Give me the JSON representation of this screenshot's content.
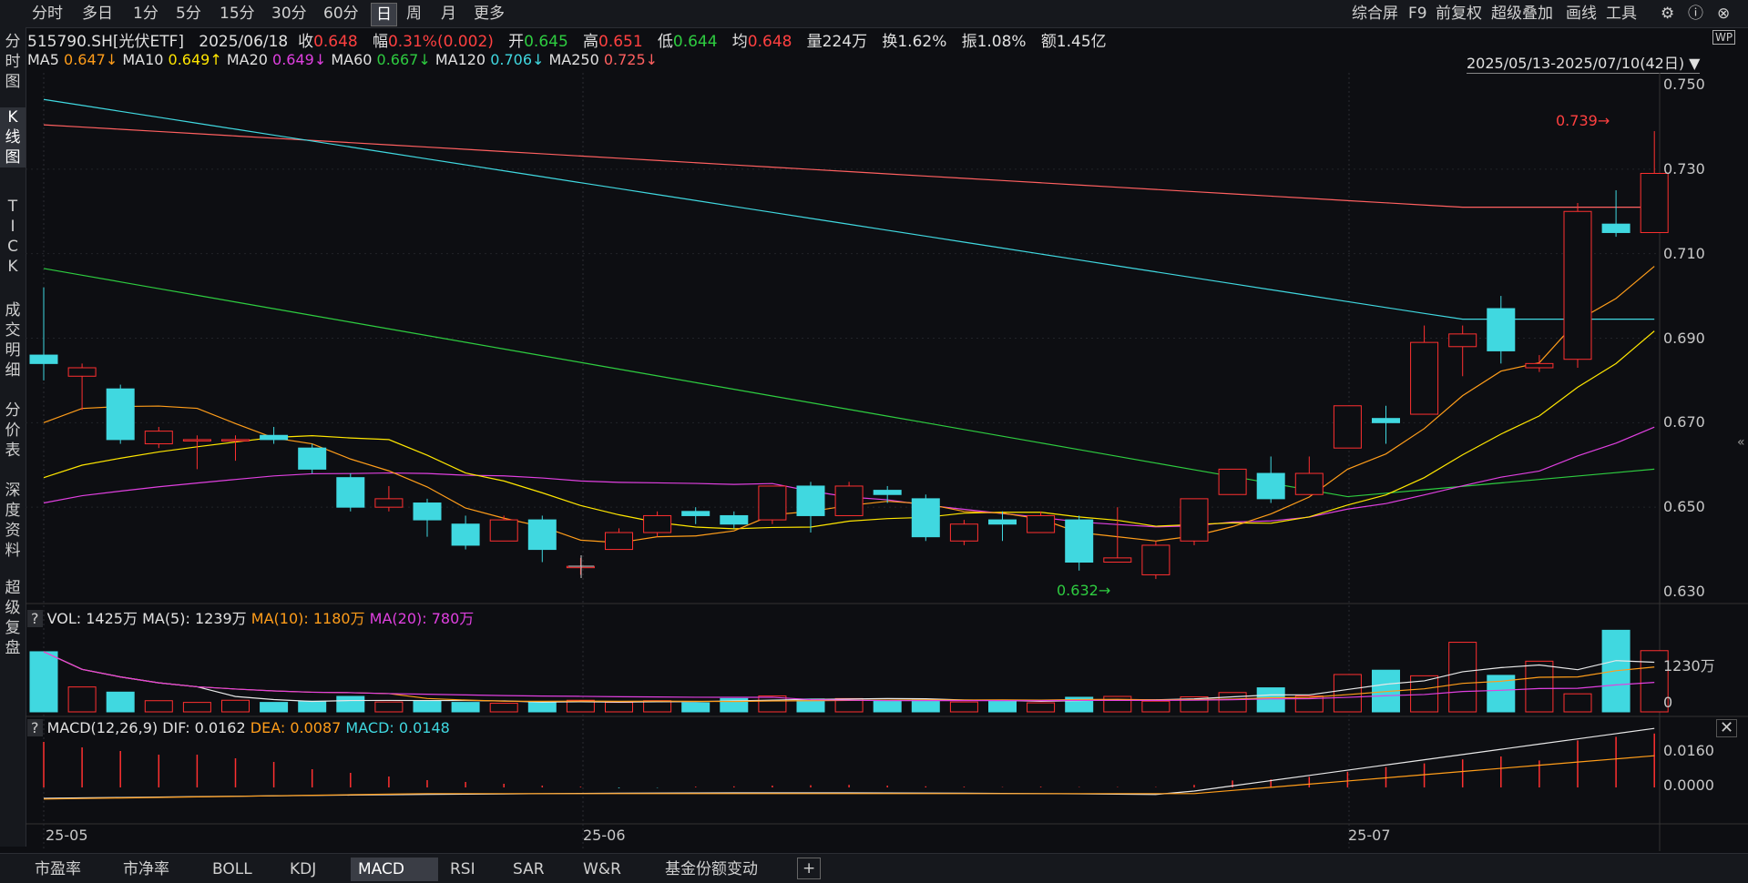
{
  "toolbar": {
    "periods": [
      "分时",
      "多日",
      "1分",
      "5分",
      "15分",
      "30分",
      "60分",
      "日",
      "周",
      "月",
      "更多"
    ],
    "active_period": "日",
    "right_items": [
      "综合屏",
      "F9",
      "前复权",
      "超级叠加",
      "画线",
      "工具"
    ]
  },
  "leftnav": {
    "items": [
      "分\n时\n图",
      "K\n线\n图",
      "T\nI\nC\nK",
      "成\n交\n明\n细",
      "分\n价\n表",
      "深\n度\n资\n料",
      "超\n级\n复\n盘"
    ],
    "active": "K\n线\n图"
  },
  "quote": {
    "code": "515790.SH[光伏ETF]",
    "date": "2025/06/18",
    "close_label": "收",
    "close": "0.648",
    "change_label": "幅",
    "change": "0.31%(0.002)",
    "open_label": "开",
    "open": "0.645",
    "high_label": "高",
    "high": "0.651",
    "low_label": "低",
    "low": "0.644",
    "avg_label": "均",
    "avg": "0.648",
    "volume": "量224万",
    "turnover_rate": "换1.62%",
    "amplitude": "振1.08%",
    "amount": "额1.45亿"
  },
  "ma_legend": [
    {
      "name": "MA5",
      "value": "0.647↓",
      "color": "#ff9d1a"
    },
    {
      "name": "MA10",
      "value": "0.649↑",
      "color": "#ffe600"
    },
    {
      "name": "MA20",
      "value": "0.649↓",
      "color": "#e040e0"
    },
    {
      "name": "MA60",
      "value": "0.667↓",
      "color": "#2ecc40"
    },
    {
      "name": "MA120",
      "value": "0.706↓",
      "color": "#40d8e0"
    },
    {
      "name": "MA250",
      "value": "0.725↓",
      "color": "#ff6060"
    }
  ],
  "date_range": "2025/05/13-2025/07/10(42日)",
  "price_axis": [
    "0.750",
    "0.730",
    "0.710",
    "0.690",
    "0.670",
    "0.650",
    "0.630"
  ],
  "annotations": {
    "max": "0.739",
    "min": "0.632"
  },
  "vol_panel": {
    "label": "VOL: 1425万",
    "ma5": "MA(5): 1239万",
    "ma10": "MA(10): 1180万",
    "ma20": "MA(20): 780万",
    "axis": [
      "1230万",
      "0"
    ]
  },
  "macd_panel": {
    "label": "MACD(12,26,9)",
    "dif": "DIF: 0.0162",
    "dea": "DEA: 0.0087",
    "macd": "MACD: 0.0148",
    "axis": [
      "0.0160",
      "0.0000"
    ]
  },
  "x_axis": [
    "25-05",
    "25-06",
    "25-07"
  ],
  "bottom_tabs": [
    "市盈率",
    "市净率",
    "BOLL",
    "KDJ",
    "MACD",
    "RSI",
    "SAR",
    "W&R",
    "基金份额变动"
  ],
  "active_tab": "MACD",
  "chart_data": {
    "type": "candlestick",
    "candles": [
      {
        "o": 0.686,
        "c": 0.684,
        "h": 0.702,
        "l": 0.68
      },
      {
        "o": 0.681,
        "c": 0.683,
        "h": 0.684,
        "l": 0.673
      },
      {
        "o": 0.678,
        "c": 0.666,
        "h": 0.679,
        "l": 0.665
      },
      {
        "o": 0.665,
        "c": 0.668,
        "h": 0.669,
        "l": 0.664
      },
      {
        "o": 0.666,
        "c": 0.666,
        "h": 0.667,
        "l": 0.659
      },
      {
        "o": 0.666,
        "c": 0.666,
        "h": 0.667,
        "l": 0.661
      },
      {
        "o": 0.667,
        "c": 0.666,
        "h": 0.669,
        "l": 0.665
      },
      {
        "o": 0.664,
        "c": 0.659,
        "h": 0.665,
        "l": 0.658
      },
      {
        "o": 0.657,
        "c": 0.65,
        "h": 0.658,
        "l": 0.649
      },
      {
        "o": 0.65,
        "c": 0.652,
        "h": 0.655,
        "l": 0.649
      },
      {
        "o": 0.651,
        "c": 0.647,
        "h": 0.652,
        "l": 0.643
      },
      {
        "o": 0.646,
        "c": 0.641,
        "h": 0.648,
        "l": 0.64
      },
      {
        "o": 0.642,
        "c": 0.647,
        "h": 0.648,
        "l": 0.642
      },
      {
        "o": 0.647,
        "c": 0.64,
        "h": 0.648,
        "l": 0.637
      },
      {
        "o": 0.636,
        "c": 0.636,
        "h": 0.638,
        "l": 0.634
      },
      {
        "o": 0.64,
        "c": 0.644,
        "h": 0.645,
        "l": 0.64
      },
      {
        "o": 0.644,
        "c": 0.648,
        "h": 0.649,
        "l": 0.643
      },
      {
        "o": 0.649,
        "c": 0.648,
        "h": 0.65,
        "l": 0.646
      },
      {
        "o": 0.648,
        "c": 0.646,
        "h": 0.649,
        "l": 0.645
      },
      {
        "o": 0.647,
        "c": 0.655,
        "h": 0.655,
        "l": 0.646
      },
      {
        "o": 0.655,
        "c": 0.648,
        "h": 0.656,
        "l": 0.644
      },
      {
        "o": 0.648,
        "c": 0.655,
        "h": 0.656,
        "l": 0.648
      },
      {
        "o": 0.654,
        "c": 0.653,
        "h": 0.655,
        "l": 0.651
      },
      {
        "o": 0.652,
        "c": 0.643,
        "h": 0.653,
        "l": 0.642
      },
      {
        "o": 0.642,
        "c": 0.646,
        "h": 0.647,
        "l": 0.641
      },
      {
        "o": 0.647,
        "c": 0.646,
        "h": 0.649,
        "l": 0.642
      },
      {
        "o": 0.644,
        "c": 0.648,
        "h": 0.649,
        "l": 0.644
      },
      {
        "o": 0.647,
        "c": 0.637,
        "h": 0.648,
        "l": 0.635
      },
      {
        "o": 0.637,
        "c": 0.638,
        "h": 0.65,
        "l": 0.637
      },
      {
        "o": 0.634,
        "c": 0.641,
        "h": 0.642,
        "l": 0.633
      },
      {
        "o": 0.642,
        "c": 0.652,
        "h": 0.652,
        "l": 0.641
      },
      {
        "o": 0.653,
        "c": 0.659,
        "h": 0.659,
        "l": 0.653
      },
      {
        "o": 0.658,
        "c": 0.652,
        "h": 0.662,
        "l": 0.651
      },
      {
        "o": 0.653,
        "c": 0.658,
        "h": 0.662,
        "l": 0.653
      },
      {
        "o": 0.664,
        "c": 0.674,
        "h": 0.674,
        "l": 0.664
      },
      {
        "o": 0.671,
        "c": 0.67,
        "h": 0.674,
        "l": 0.665
      },
      {
        "o": 0.672,
        "c": 0.689,
        "h": 0.693,
        "l": 0.672
      },
      {
        "o": 0.688,
        "c": 0.691,
        "h": 0.693,
        "l": 0.681
      },
      {
        "o": 0.697,
        "c": 0.687,
        "h": 0.7,
        "l": 0.684
      },
      {
        "o": 0.683,
        "c": 0.684,
        "h": 0.686,
        "l": 0.682
      },
      {
        "o": 0.685,
        "c": 0.72,
        "h": 0.722,
        "l": 0.683
      },
      {
        "o": 0.717,
        "c": 0.715,
        "h": 0.725,
        "l": 0.714
      },
      {
        "o": 0.715,
        "c": 0.729,
        "h": 0.739,
        "l": 0.715
      }
    ],
    "volume": [
      1400,
      580,
      460,
      260,
      220,
      270,
      220,
      250,
      360,
      230,
      260,
      220,
      200,
      230,
      270,
      220,
      260,
      210,
      310,
      370,
      300,
      310,
      260,
      280,
      230,
      250,
      210,
      340,
      360,
      250,
      350,
      450,
      560,
      370,
      870,
      970,
      840,
      1620,
      850,
      1180,
      420,
      1900,
      1425,
      1370
    ],
    "macd_hist": [
      0.0125,
      0.011,
      0.01,
      0.009,
      0.009,
      0.008,
      0.007,
      0.005,
      0.004,
      0.003,
      0.002,
      0.0015,
      0.001,
      0.0005,
      0.0002,
      -0.0002,
      -0.0001,
      0.0002,
      0.0003,
      0.0005,
      0.0006,
      0.0007,
      0.0005,
      0.0003,
      0.0002,
      0.0001,
      0.0002,
      0.0001,
      0.0001,
      0.0001,
      0.0007,
      0.0019,
      0.0022,
      0.0029,
      0.0043,
      0.0056,
      0.0066,
      0.0077,
      0.0085,
      0.0074,
      0.0129,
      0.0139,
      0.0148
    ]
  }
}
